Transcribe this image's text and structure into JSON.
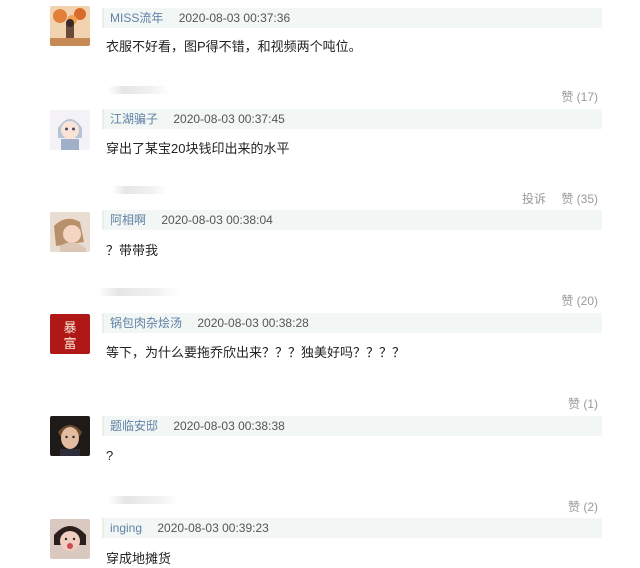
{
  "comments": [
    {
      "username": "MISS流年",
      "time": "2020-08-03 00:37:36",
      "text": "衣服不好看，图P得不错，和视频两个吨位。",
      "like_label": "赞 (17)",
      "avatar_icon": "autumn-illustration-avatar"
    },
    {
      "username": "江湖骗子",
      "time": "2020-08-03 00:37:45",
      "text": "穿出了某宝20块钱印出来的水平",
      "report_label": "投诉",
      "like_label": "赞 (35)",
      "avatar_icon": "chibi-character-avatar"
    },
    {
      "username": "阿相啊",
      "time": "2020-08-03 00:38:04",
      "text": "？带带我",
      "like_label": "赞 (20)",
      "avatar_icon": "portrait-photo-avatar"
    },
    {
      "username": "锅包肉杂烩汤",
      "time": "2020-08-03 00:38:28",
      "text": "等下，为什么要拖乔欣出来？？？独美好吗？？？？",
      "like_label": "赞 (1)",
      "avatar_icon": "red-character-avatar",
      "avatar_glyphs": "暴富"
    },
    {
      "username": "题临安邸",
      "time": "2020-08-03 00:38:38",
      "text": "?",
      "like_label": "赞 (2)",
      "avatar_icon": "dark-portrait-avatar"
    },
    {
      "username": "inging",
      "time": "2020-08-03 00:39:23",
      "text": "穿成地摊货",
      "avatar_icon": "child-photo-avatar"
    }
  ],
  "colors": {
    "username": "#5f81a6",
    "meta_bg": "#f2f6f4",
    "action_text": "#999999",
    "avatar_red": "#b01818"
  }
}
